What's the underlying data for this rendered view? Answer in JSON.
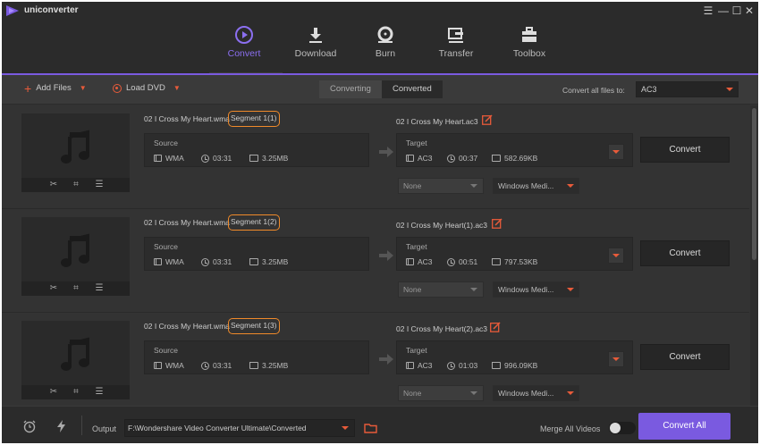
{
  "app": {
    "title": "uniconverter"
  },
  "window": {
    "menu_glyph": "☰",
    "minimize_glyph": "—",
    "maximize_glyph": "☐",
    "close_glyph": "✕"
  },
  "nav": {
    "items": [
      {
        "label": "Convert",
        "icon": "convert-icon",
        "active": true
      },
      {
        "label": "Download",
        "icon": "download-icon"
      },
      {
        "label": "Burn",
        "icon": "burn-icon"
      },
      {
        "label": "Transfer",
        "icon": "transfer-icon"
      },
      {
        "label": "Toolbox",
        "icon": "toolbox-icon"
      }
    ]
  },
  "toolbar": {
    "add_files": "Add Files",
    "load_dvd": "Load DVD",
    "tab_converting": "Converting",
    "tab_converted": "Converted",
    "convert_all_to_label": "Convert all files to:",
    "convert_all_to_value": "AC3"
  },
  "rows": [
    {
      "source_name": "02 I Cross My Heart.wma",
      "segment": "Segment 1(1)",
      "source_title": "Source",
      "source_format": "WMA",
      "source_duration": "03:31",
      "source_size": "3.25MB",
      "target_name": "02 I Cross My Heart.ac3",
      "target_title": "Target",
      "target_format": "AC3",
      "target_duration": "00:37",
      "target_size": "582.69KB",
      "subtitle": "None",
      "audio": "Windows Medi...",
      "convert_label": "Convert"
    },
    {
      "source_name": "02 I Cross My Heart.wma",
      "segment": "Segment 1(2)",
      "source_title": "Source",
      "source_format": "WMA",
      "source_duration": "03:31",
      "source_size": "3.25MB",
      "target_name": "02 I Cross My Heart(1).ac3",
      "target_title": "Target",
      "target_format": "AC3",
      "target_duration": "00:51",
      "target_size": "797.53KB",
      "subtitle": "None",
      "audio": "Windows Medi...",
      "convert_label": "Convert"
    },
    {
      "source_name": "02 I Cross My Heart.wma",
      "segment": "Segment 1(3)",
      "source_title": "Source",
      "source_format": "WMA",
      "source_duration": "03:31",
      "source_size": "3.25MB",
      "target_name": "02 I Cross My Heart(2).ac3",
      "target_title": "Target",
      "target_format": "AC3",
      "target_duration": "01:03",
      "target_size": "996.09KB",
      "subtitle": "None",
      "audio": "Windows Medi...",
      "convert_label": "Convert"
    }
  ],
  "footer": {
    "output_label": "Output",
    "output_path": "F:\\Wondershare Video Converter Ultimate\\Converted",
    "merge_label": "Merge All Videos",
    "merge_on": false,
    "convert_all": "Convert All"
  },
  "colors": {
    "accent": "#7a5ae0",
    "highlight": "#f08a2a",
    "red": "#e85b3a",
    "background": "#333333"
  }
}
